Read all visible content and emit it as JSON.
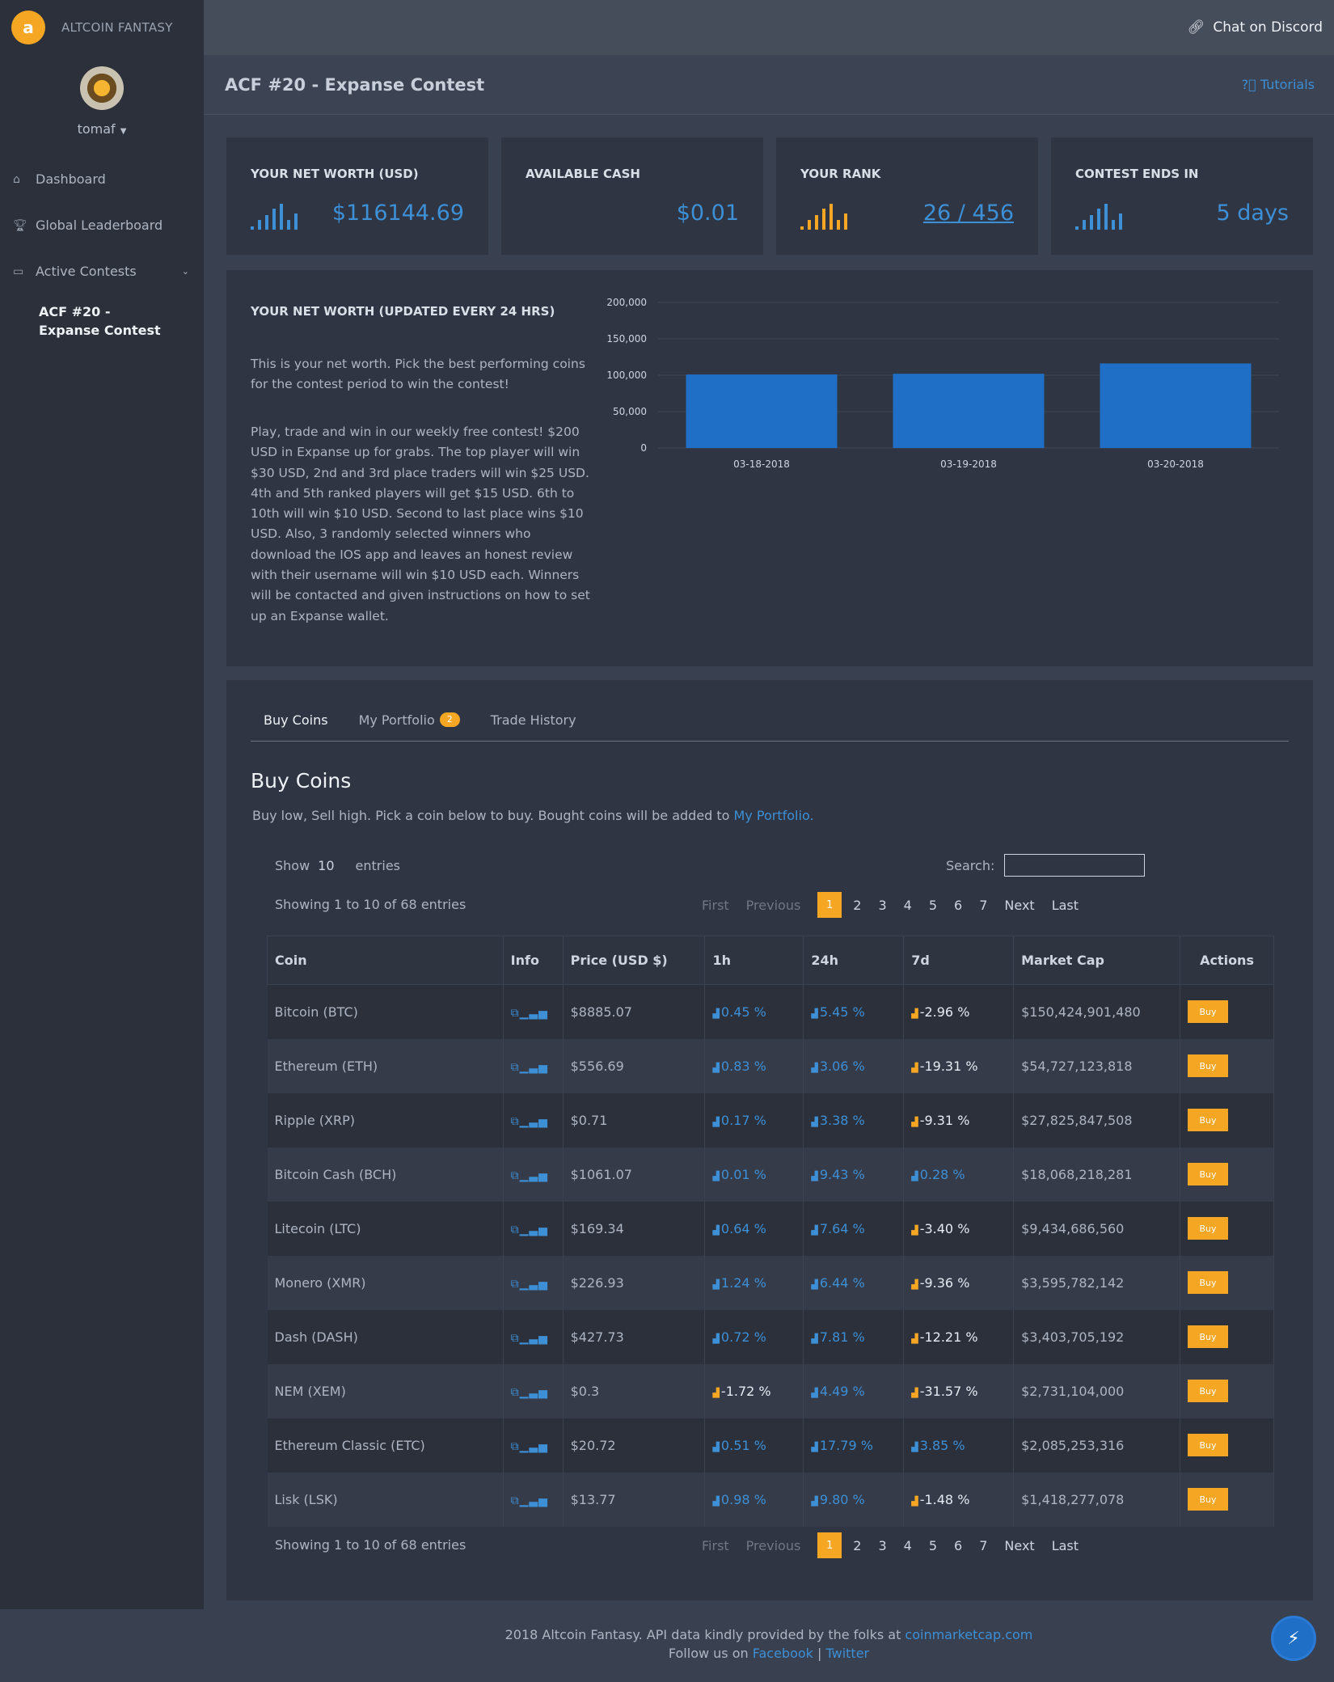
{
  "brand": {
    "logo_letter": "a",
    "name": "ALTCOIN FANTASY"
  },
  "user": {
    "name": "tomaf"
  },
  "nav": [
    {
      "label": "Dashboard",
      "icon": "home-icon"
    },
    {
      "label": "Global Leaderboard",
      "icon": "trophy-icon"
    },
    {
      "label": "Active Contests",
      "icon": "folder-icon"
    }
  ],
  "active_contest": "ACF #20 - Expanse Contest",
  "topbar": {
    "discord_label": "Chat on Discord"
  },
  "page": {
    "title": "ACF #20 - Expanse Contest",
    "tutorials": "Tutorials"
  },
  "cards": [
    {
      "label": "YOUR NET WORTH (USD)",
      "value": "$116144.69"
    },
    {
      "label": "AVAILABLE CASH",
      "value": "$0.01"
    },
    {
      "label": "YOUR RANK",
      "value": "26 / 456"
    },
    {
      "label": "CONTEST ENDS IN",
      "value": "5 days"
    }
  ],
  "networth": {
    "title": "YOUR NET WORTH (UPDATED EVERY 24 HRS)",
    "p1": "This is your net worth. Pick the best performing coins for the contest period to win the contest!",
    "p2": "Play, trade and win in our weekly free contest! $200 USD in Expanse up for grabs. The top player will win $30 USD, 2nd and 3rd place traders will win $25 USD. 4th and 5th ranked players will get $15 USD. 6th to 10th will win $10 USD. Second to last place wins $10 USD. Also, 3 randomly selected winners who download the IOS app and leaves an honest review with their username will win $10 USD each. Winners will be contacted and given instructions on how to set up an Expanse wallet."
  },
  "chart_data": {
    "type": "bar",
    "categories": [
      "03-18-2018",
      "03-19-2018",
      "03-20-2018"
    ],
    "values": [
      101000,
      102000,
      116144.69
    ],
    "ylim": [
      0,
      200000
    ],
    "yticks": [
      "0",
      "50,000",
      "100,000",
      "150,000",
      "200,000"
    ],
    "title": "",
    "xlabel": "",
    "ylabel": "",
    "bar_color": "#1f6fc7",
    "grid": true
  },
  "tabs": {
    "buy": "Buy Coins",
    "portfolio": "My Portfolio",
    "portfolio_badge": "2",
    "history": "Trade History"
  },
  "buy": {
    "heading": "Buy Coins",
    "subtitle": "Buy low, Sell high. Pick a coin below to buy. Bought coins will be added to ",
    "subtitle_link": "My Portfolio.",
    "show_label": "Show",
    "show_value": "10",
    "entries_label": "entries",
    "search_label": "Search:",
    "search_value": "",
    "info_text": "Showing 1 to 10 of 68 entries"
  },
  "pager": {
    "first": "First",
    "previous": "Previous",
    "current": "1",
    "pages": [
      "2",
      "3",
      "4",
      "5",
      "6",
      "7"
    ],
    "next": "Next",
    "last": "Last"
  },
  "table": {
    "headers": [
      "Coin",
      "Info",
      "Price (USD $)",
      "1h",
      "24h",
      "7d",
      "Market Cap",
      "Actions"
    ],
    "buy_label": "Buy",
    "rows": [
      {
        "coin": "Bitcoin (BTC)",
        "price": "$8885.07",
        "h1": "0.45 %",
        "h24": "5.45 %",
        "d7": "-2.96 %",
        "cap": "$150,424,901,480"
      },
      {
        "coin": "Ethereum (ETH)",
        "price": "$556.69",
        "h1": "0.83 %",
        "h24": "3.06 %",
        "d7": "-19.31 %",
        "cap": "$54,727,123,818"
      },
      {
        "coin": "Ripple (XRP)",
        "price": "$0.71",
        "h1": "0.17 %",
        "h24": "3.38 %",
        "d7": "-9.31 %",
        "cap": "$27,825,847,508"
      },
      {
        "coin": "Bitcoin Cash (BCH)",
        "price": "$1061.07",
        "h1": "0.01 %",
        "h24": "9.43 %",
        "d7": "0.28 %",
        "cap": "$18,068,218,281"
      },
      {
        "coin": "Litecoin (LTC)",
        "price": "$169.34",
        "h1": "0.64 %",
        "h24": "7.64 %",
        "d7": "-3.40 %",
        "cap": "$9,434,686,560"
      },
      {
        "coin": "Monero (XMR)",
        "price": "$226.93",
        "h1": "1.24 %",
        "h24": "6.44 %",
        "d7": "-9.36 %",
        "cap": "$3,595,782,142"
      },
      {
        "coin": "Dash (DASH)",
        "price": "$427.73",
        "h1": "0.72 %",
        "h24": "7.81 %",
        "d7": "-12.21 %",
        "cap": "$3,403,705,192"
      },
      {
        "coin": "NEM (XEM)",
        "price": "$0.3",
        "h1": "-1.72 %",
        "h24": "4.49 %",
        "d7": "-31.57 %",
        "cap": "$2,731,104,000"
      },
      {
        "coin": "Ethereum Classic (ETC)",
        "price": "$20.72",
        "h1": "0.51 %",
        "h24": "17.79 %",
        "d7": "3.85 %",
        "cap": "$2,085,253,316"
      },
      {
        "coin": "Lisk (LSK)",
        "price": "$13.77",
        "h1": "0.98 %",
        "h24": "9.80 %",
        "d7": "-1.48 %",
        "cap": "$1,418,277,078"
      }
    ]
  },
  "footer": {
    "line1": "2018 Altcoin Fantasy. API data kindly provided by the folks at ",
    "cmc": "coinmarketcap.com",
    "follow": "Follow us on ",
    "facebook": "Facebook",
    "sep": " | ",
    "twitter": "Twitter"
  },
  "colors": {
    "accent": "#3d8fd6",
    "orange": "#f5a623",
    "bg": "#394050",
    "sidebar": "#2b303a",
    "panel": "#2f3542"
  }
}
